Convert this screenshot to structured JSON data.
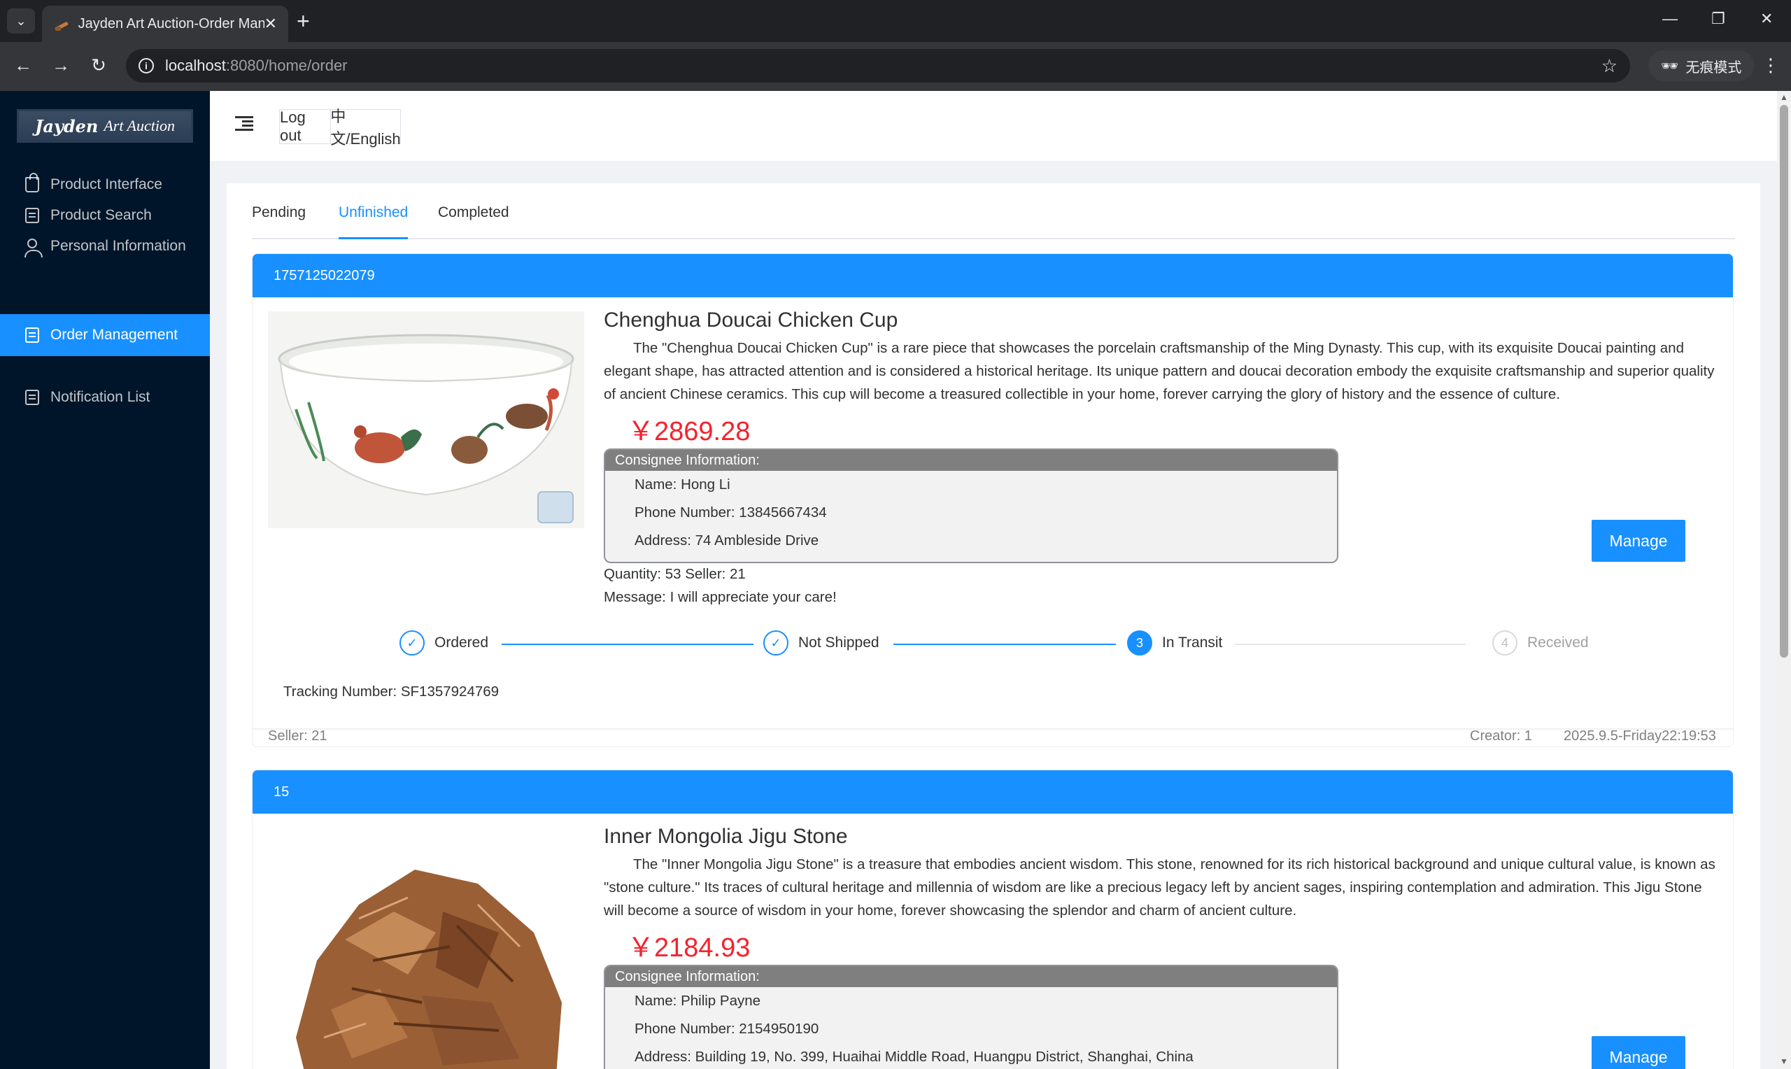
{
  "browser": {
    "tab_title": "Jayden Art Auction-Order Management",
    "url_host": "localhost",
    "url_rest": ":8080/home/order",
    "incognito_label": "无痕模式"
  },
  "sidebar": {
    "logo_bold": "Jayden",
    "logo_rest": "Art Auction",
    "items": [
      {
        "label": "Product Interface",
        "icon": "bag-icon"
      },
      {
        "label": "Product Search",
        "icon": "search-doc-icon"
      },
      {
        "label": "Personal Information",
        "icon": "user-icon"
      },
      {
        "label": "Order Management",
        "icon": "order-icon",
        "active": true
      },
      {
        "label": "Notification List",
        "icon": "notification-doc-icon"
      }
    ]
  },
  "header": {
    "logout_label": "Log out",
    "lang_label": "中文/English"
  },
  "tabs": [
    {
      "label": "Pending"
    },
    {
      "label": "Unfinished",
      "active": true
    },
    {
      "label": "Completed"
    }
  ],
  "orders": [
    {
      "id": "1757125022079",
      "title": "Chenghua Doucai Chicken Cup",
      "description": "The \"Chenghua Doucai Chicken Cup\" is a rare piece that showcases the porcelain craftsmanship of the Ming Dynasty. This cup, with its exquisite Doucai painting and elegant shape, has attracted attention and is considered a historical heritage. Its unique pattern and doucai decoration embody the exquisite craftsmanship and superior quality of ancient Chinese ceramics. This cup will become a treasured collectible in your home, forever carrying the glory of history and the essence of culture.",
      "price": "￥2869.28",
      "consignee_header": "Consignee Information:",
      "name": "Name: Hong Li",
      "phone": "Phone Number: 13845667434",
      "address": "Address: 74 Ambleside Drive",
      "quantity_seller": "Quantity: 53 Seller: 21",
      "message": "Message: I will appreciate your care!",
      "manage_label": "Manage",
      "steps": [
        {
          "label": "Ordered",
          "state": "finished",
          "num": "✓"
        },
        {
          "label": "Not Shipped",
          "state": "finished",
          "num": "✓"
        },
        {
          "label": "In Transit",
          "state": "process",
          "num": "3"
        },
        {
          "label": "Received",
          "state": "wait",
          "num": "4"
        }
      ],
      "tracking": "Tracking Number: SF1357924769",
      "seller_footer": "Seller: 21",
      "creator": "Creator: 1",
      "date": "2025.9.5-Friday22:19:53"
    },
    {
      "id": "15",
      "title": "Inner Mongolia Jigu Stone",
      "description": "The \"Inner Mongolia Jigu Stone\" is a treasure that embodies ancient wisdom. This stone, renowned for its rich historical background and unique cultural value, is known as \"stone culture.\" Its traces of cultural heritage and millennia of wisdom are like a precious legacy left by ancient sages, inspiring contemplation and admiration. This Jigu Stone will become a source of wisdom in your home, forever showcasing the splendor and charm of ancient culture.",
      "price": "￥2184.93",
      "consignee_header": "Consignee Information:",
      "name": "Name: Philip Payne",
      "phone": "Phone Number: 2154950190",
      "address": "Address: Building 19, No. 399, Huaihai Middle Road, Huangpu District, Shanghai, China",
      "manage_label": "Manage"
    }
  ],
  "colors": {
    "primary": "#1890ff",
    "sidebar_bg": "#001529",
    "price": "#f5222d"
  }
}
